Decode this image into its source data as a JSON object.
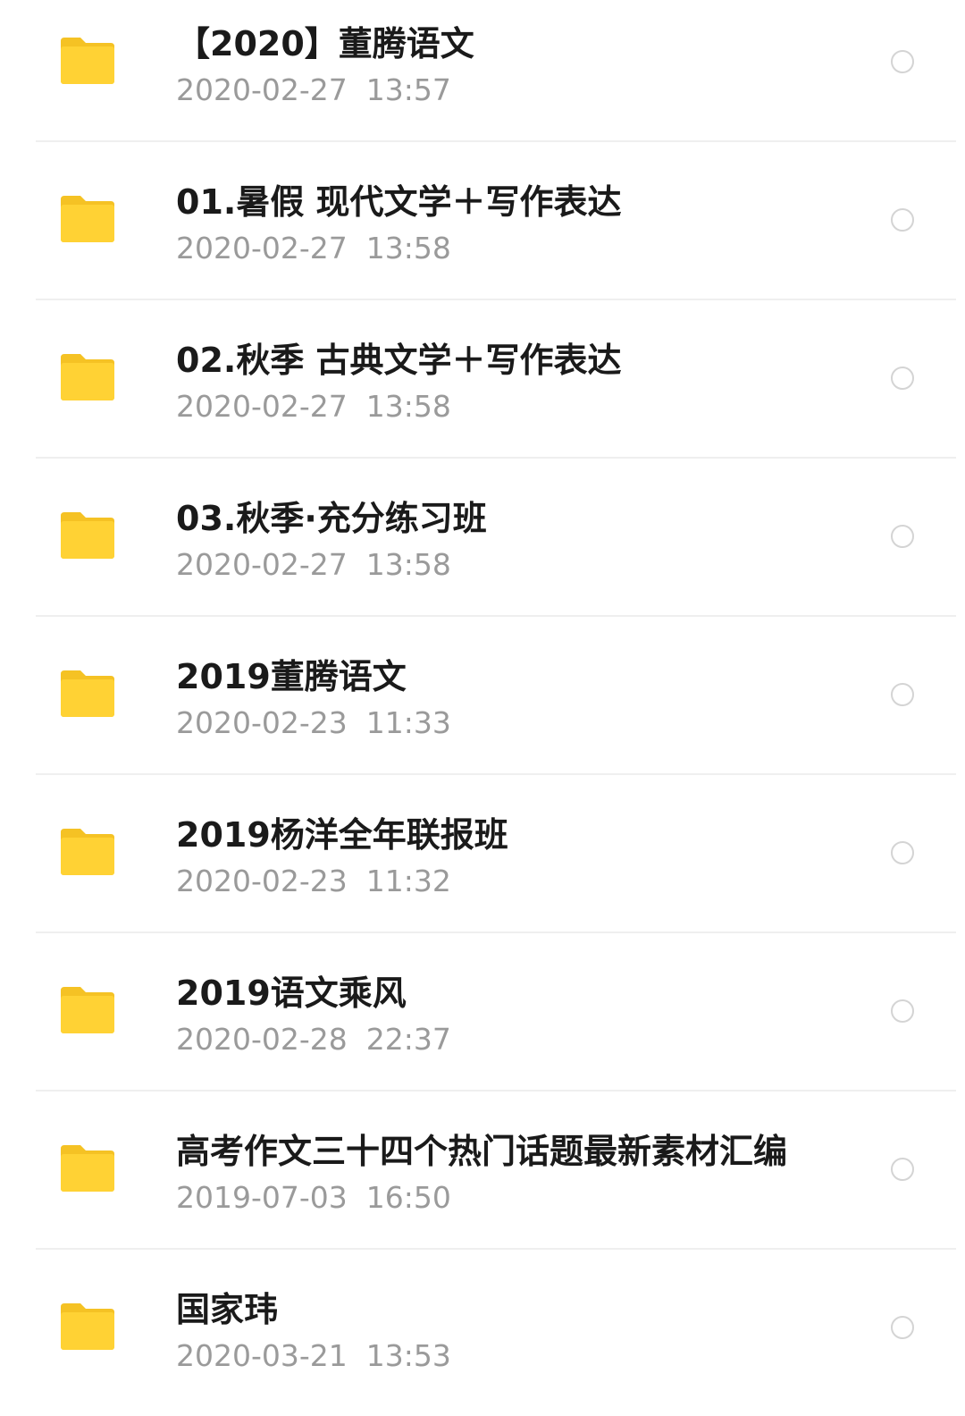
{
  "colors": {
    "folder": "#ffd234",
    "folder_tab": "#f5c224",
    "title_text": "#1a1a1a",
    "time_text": "#9a9a9a",
    "divider": "#efefef",
    "circle_border": "#d4d4d4"
  },
  "icons": {
    "item": "folder-icon",
    "select": "radio-circle-icon"
  },
  "files": [
    {
      "name": "【2020】董腾语文",
      "time": "2020-02-27  13:57"
    },
    {
      "name": "01.暑假 现代文学＋写作表达",
      "time": "2020-02-27  13:58"
    },
    {
      "name": "02.秋季 古典文学＋写作表达",
      "time": "2020-02-27  13:58"
    },
    {
      "name": "03.秋季·充分练习班",
      "time": "2020-02-27  13:58"
    },
    {
      "name": "2019董腾语文",
      "time": "2020-02-23  11:33"
    },
    {
      "name": "2019杨洋全年联报班",
      "time": "2020-02-23  11:32"
    },
    {
      "name": "2019语文乘风",
      "time": "2020-02-28  22:37"
    },
    {
      "name": "高考作文三十四个热门话题最新素材汇编",
      "time": "2019-07-03  16:50"
    },
    {
      "name": "国家玮",
      "time": "2020-03-21  13:53"
    }
  ]
}
